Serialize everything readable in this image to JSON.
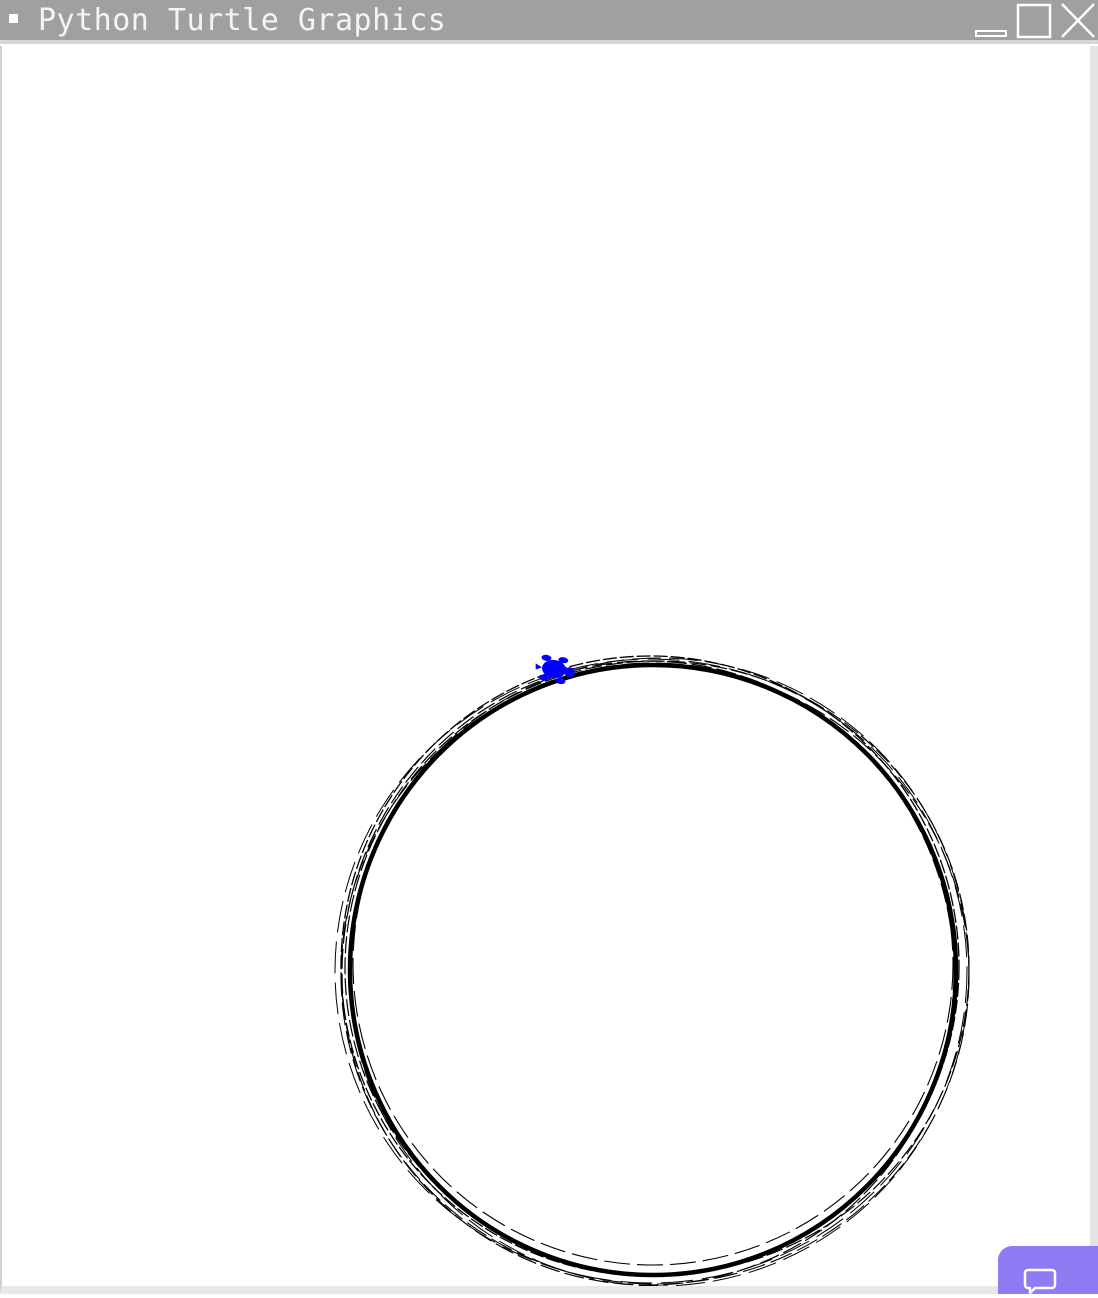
{
  "window": {
    "title": "Python Turtle Graphics",
    "controls": {
      "minimize": "minimize-icon",
      "maximize": "maximize-icon",
      "close": "close-icon"
    }
  },
  "canvas": {
    "background": "#ffffff",
    "pen_color": "#000000",
    "turtle_color": "#0000ff",
    "turtle_shape": "turtle"
  },
  "overlay": {
    "chat_button_icon": "chat-bubble-icon",
    "chat_button_color": "#8f7cf5"
  }
}
